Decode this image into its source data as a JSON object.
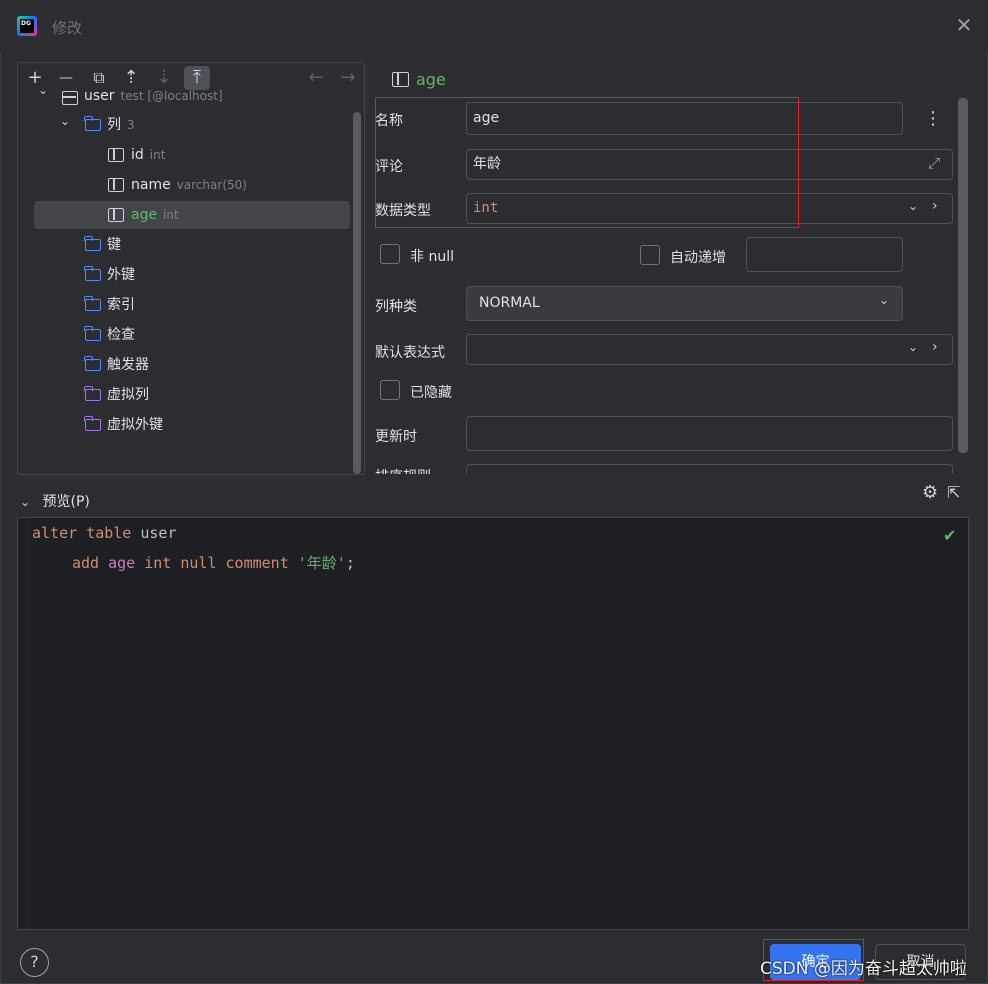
{
  "window": {
    "title": "修改",
    "logo_text": "DG"
  },
  "toolbar": {
    "add": "+",
    "remove": "—",
    "copy": "⧉",
    "move_up": "⇡",
    "move_down": "⇣",
    "move_top": "⤒",
    "back": "←",
    "forward": "→"
  },
  "tree": {
    "table": {
      "label": "user",
      "sub": "test [@localhost]"
    },
    "columns_folder": {
      "label": "列",
      "count": "3"
    },
    "columns": [
      {
        "label": "id",
        "type": "int"
      },
      {
        "label": "name",
        "type": "varchar(50)"
      },
      {
        "label": "age",
        "type": "int"
      }
    ],
    "folders": [
      "键",
      "外键",
      "索引",
      "检查",
      "触发器"
    ],
    "virtual_folders": [
      "虚拟列",
      "虚拟外键"
    ]
  },
  "form": {
    "header_title": "age",
    "name_label": "名称",
    "name_value": "age",
    "comment_label": "评论",
    "comment_value": "年龄",
    "type_label": "数据类型",
    "type_value": "int",
    "not_null_label": "非 null",
    "auto_increment_label": "自动递增",
    "column_kind_label": "列种类",
    "column_kind_value": "NORMAL",
    "default_expr_label": "默认表达式",
    "default_expr_value": "",
    "hidden_label": "已隐藏",
    "on_update_label": "更新时",
    "on_update_value": "",
    "collation_label": "排序规则"
  },
  "preview": {
    "label": "预览(P)",
    "line1": {
      "kw1": "alter",
      "kw2": "table",
      "table": "user"
    },
    "line2": {
      "kw1": "add",
      "col": "age",
      "type": "int",
      "null": "null",
      "kw2": "comment",
      "str": "'年龄'",
      "end": ";"
    }
  },
  "footer": {
    "help": "?",
    "ok": "确定",
    "cancel": "取消"
  },
  "watermark": "CSDN @因为奋斗超太帅啦"
}
